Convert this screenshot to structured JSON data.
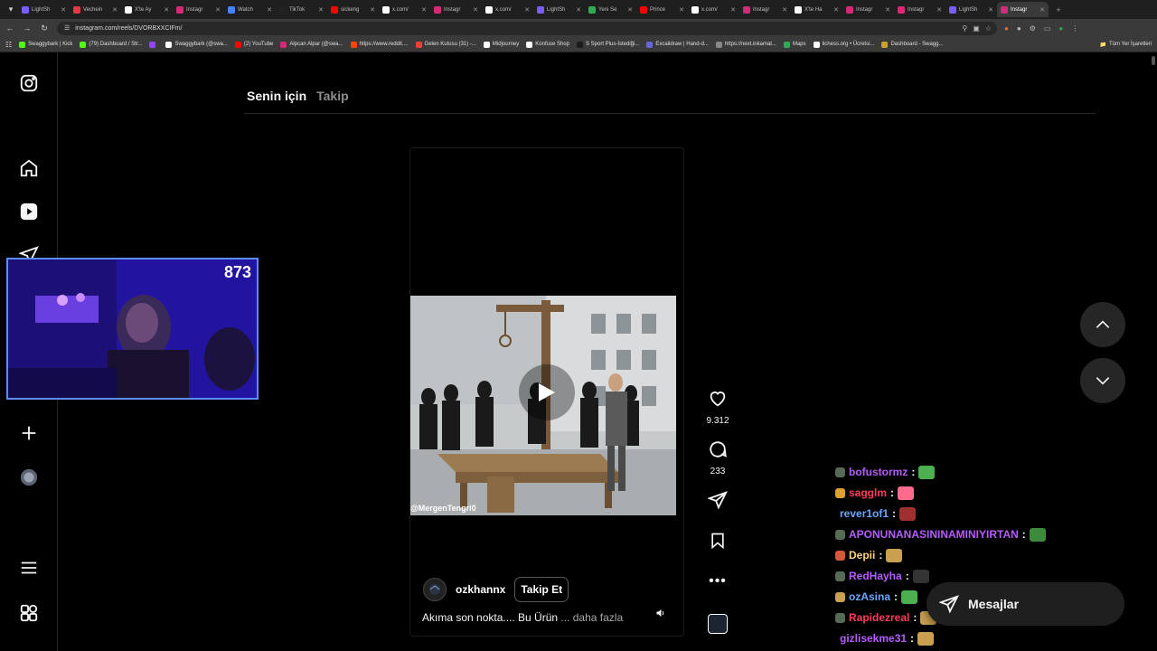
{
  "browser": {
    "tabs": [
      {
        "label": "LightSh",
        "color": "#7b5cff"
      },
      {
        "label": "Vechein",
        "color": "#e63946"
      },
      {
        "label": "X'te Ay",
        "color": "#ffffff"
      },
      {
        "label": "Instagr",
        "color": "#d62976"
      },
      {
        "label": "Watch",
        "color": "#4285f4"
      },
      {
        "label": "TikTok",
        "color": "#222222"
      },
      {
        "label": "sickeng",
        "color": "#ff0000"
      },
      {
        "label": "x.com/",
        "color": "#ffffff"
      },
      {
        "label": "Instagr",
        "color": "#d62976"
      },
      {
        "label": "x.com/",
        "color": "#ffffff"
      },
      {
        "label": "LightSh",
        "color": "#7b5cff"
      },
      {
        "label": "Yeni Se",
        "color": "#34a853"
      },
      {
        "label": "Prince",
        "color": "#ff0000"
      },
      {
        "label": "x.com/",
        "color": "#ffffff"
      },
      {
        "label": "Instagr",
        "color": "#d62976"
      },
      {
        "label": "X'te Ha",
        "color": "#ffffff"
      },
      {
        "label": "Instagr",
        "color": "#d62976"
      },
      {
        "label": "Instagr",
        "color": "#d62976"
      },
      {
        "label": "LightSh",
        "color": "#7b5cff"
      },
      {
        "label": "Instagr",
        "color": "#d62976"
      }
    ],
    "url": "instagram.com/reels/DVORBXXCIFm/",
    "bookmarks": [
      {
        "label": "Swaggybark | Kick",
        "color": "#53fc18"
      },
      {
        "label": "(79) Dashboard / Str...",
        "color": "#53fc18"
      },
      {
        "label": "",
        "color": "#9146ff"
      },
      {
        "label": "Swaggybark (@swa...",
        "color": "#ffffff"
      },
      {
        "label": "(2) YouTube",
        "color": "#ff0000"
      },
      {
        "label": "Alpcan Alpar (@swa...",
        "color": "#d62976"
      },
      {
        "label": "https://www.reddit....",
        "color": "#ff4500"
      },
      {
        "label": "Gelen Kutusu (31) -...",
        "color": "#ea4335"
      },
      {
        "label": "Midjourney",
        "color": "#ffffff"
      },
      {
        "label": "Konfuse Shop",
        "color": "#ffffff"
      },
      {
        "label": "S Sport Plus-İstediği...",
        "color": "#1a1a1a"
      },
      {
        "label": "Excalidraw | Hand-d...",
        "color": "#6965db"
      },
      {
        "label": "https://next.inkamat...",
        "color": "#888888"
      },
      {
        "label": "Maps",
        "color": "#34a853"
      },
      {
        "label": "lichess.org • Ücretsi...",
        "color": "#ffffff"
      },
      {
        "label": "Dashboard - Swagg...",
        "color": "#c9a227"
      }
    ],
    "all_bookmarks": "Tüm Yer İşaretleri"
  },
  "feed_tabs": {
    "for_you": "Senin için",
    "following": "Takip"
  },
  "reel": {
    "username": "ozkhannx",
    "follow_label": "Takip Et",
    "caption": "Akıma son nokta.... Bu Ürün",
    "more_label": " ... daha fazla",
    "watermark": "@MergenTengri0",
    "likes": "9.312",
    "comments": "233"
  },
  "stream_overlay": {
    "viewer_count": "873",
    "chat": [
      {
        "user": "bofustormz",
        "color": "#b65cff",
        "badge": "#556b55",
        "emote": "#4caf50"
      },
      {
        "user": "sagglm",
        "color": "#ff3b5c",
        "badge": "#e0a030",
        "emote": "#ff6b8a"
      },
      {
        "user": "rever1of1",
        "color": "#6aa7ff",
        "badge": "",
        "emote": "#a03030"
      },
      {
        "user": "APONUNANASININAMINIYIRTAN",
        "color": "#b65cff",
        "badge": "#556b55",
        "emote": "#3c8a3c"
      },
      {
        "user": "Depii",
        "color": "#ffd27f",
        "badge": "#d4593a",
        "emote": "#c9a050"
      },
      {
        "user": "RedHayha",
        "color": "#b65cff",
        "badge": "#556b55",
        "emote": "#333333"
      },
      {
        "user": "ozAsina",
        "color": "#6aa7ff",
        "badge": "#c9a050",
        "emote": "#4caf50"
      },
      {
        "user": "Rapidezreal",
        "color": "#ff3b5c",
        "badge": "#556b55",
        "emote": "#c9a050"
      },
      {
        "user": "gizlisekme31",
        "color": "#b65cff",
        "badge": "",
        "emote": "#c9a050"
      }
    ]
  },
  "messages_label": "Mesajlar"
}
